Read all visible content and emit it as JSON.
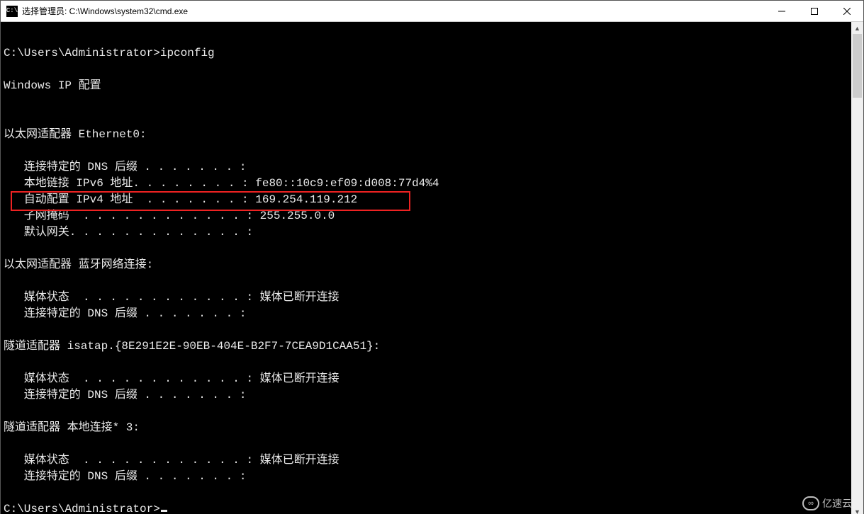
{
  "titlebar": {
    "icon_text": "C:\\",
    "title": "选择管理员: C:\\Windows\\system32\\cmd.exe"
  },
  "window_controls": {
    "minimize": "minimize",
    "maximize": "maximize",
    "close": "close"
  },
  "terminal": {
    "lines": [
      "",
      "C:\\Users\\Administrator>ipconfig",
      "",
      "Windows IP 配置",
      "",
      "",
      "以太网适配器 Ethernet0:",
      "",
      "   连接特定的 DNS 后缀 . . . . . . . :",
      "   本地链接 IPv6 地址. . . . . . . . : fe80::10c9:ef09:d008:77d4%4",
      "   自动配置 IPv4 地址  . . . . . . . : 169.254.119.212",
      "   子网掩码  . . . . . . . . . . . . : 255.255.0.0",
      "   默认网关. . . . . . . . . . . . . :",
      "",
      "以太网适配器 蓝牙网络连接:",
      "",
      "   媒体状态  . . . . . . . . . . . . : 媒体已断开连接",
      "   连接特定的 DNS 后缀 . . . . . . . :",
      "",
      "隧道适配器 isatap.{8E291E2E-90EB-404E-B2F7-7CEA9D1CAA51}:",
      "",
      "   媒体状态  . . . . . . . . . . . . : 媒体已断开连接",
      "   连接特定的 DNS 后缀 . . . . . . . :",
      "",
      "隧道适配器 本地连接* 3:",
      "",
      "   媒体状态  . . . . . . . . . . . . : 媒体已断开连接",
      "   连接特定的 DNS 后缀 . . . . . . . :",
      "",
      "C:\\Users\\Administrator>"
    ],
    "highlight_index": 10
  },
  "watermark": {
    "logo": "∞",
    "text": "亿速云"
  }
}
